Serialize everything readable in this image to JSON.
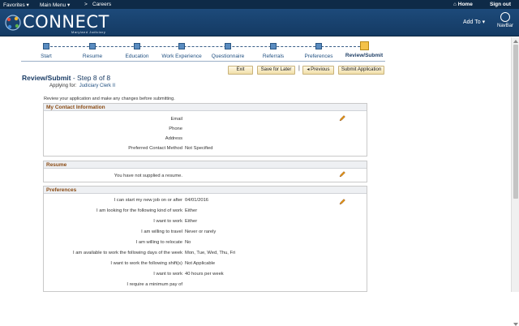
{
  "topbar": {
    "favorites": "Favorites",
    "main_menu": "Main Menu",
    "breadcrumb_sep": ">",
    "careers": "Careers",
    "home": "Home",
    "sign_out": "Sign out"
  },
  "header": {
    "logo_text": "CONNECT",
    "logo_sub": "Maryland Judiciary",
    "add_to": "Add To",
    "navbar": "NavBar"
  },
  "steps": [
    {
      "label": "Start"
    },
    {
      "label": "Resume"
    },
    {
      "label": "Education"
    },
    {
      "label": "Work Experience"
    },
    {
      "label": "Questionnaire"
    },
    {
      "label": "Referrals"
    },
    {
      "label": "Preferences"
    },
    {
      "label": "Review/Submit"
    }
  ],
  "buttons": {
    "exit": "Exit",
    "save_later": "Save for Later",
    "separator": "|",
    "previous": "Previous",
    "submit": "Submit Application"
  },
  "page": {
    "title": "Review/Submit",
    "step_text": "- Step 8 of 8",
    "applying_label": "Applying for:",
    "applying_value": "Judiciary Clerk II",
    "review_note": "Review your application and make any changes before submitting."
  },
  "contact": {
    "heading": "My Contact Information",
    "email_label": "Email",
    "phone_label": "Phone",
    "address_label": "Address",
    "preferred_label": "Preferred Contact Method",
    "preferred_value": "Not Specified"
  },
  "resume": {
    "heading": "Resume",
    "message": "You have not supplied a resume."
  },
  "preferences": {
    "heading": "Preferences",
    "rows": [
      {
        "label": "I can start my new job on or after",
        "value": "04/01/2016"
      },
      {
        "label": "I am looking for the following kind of work",
        "value": "Either"
      },
      {
        "label": "I want to work",
        "value": "Either"
      },
      {
        "label": "I am willing to travel",
        "value": "Never or rarely"
      },
      {
        "label": "I am willing to relocate",
        "value": "No"
      },
      {
        "label": "I am available to work the following days of the week",
        "value": "Mon, Tue, Wed, Thu, Fri"
      },
      {
        "label": "I want to work the following shift(s)",
        "value": "Not Applicable"
      },
      {
        "label": "I want to work",
        "value": "40 hours per week"
      },
      {
        "label": "I require a minimum pay of",
        "value": ""
      }
    ]
  },
  "colors": {
    "header_bg": "#143a63",
    "section_title": "#8a4b14",
    "current_step": "#f4c24a"
  }
}
